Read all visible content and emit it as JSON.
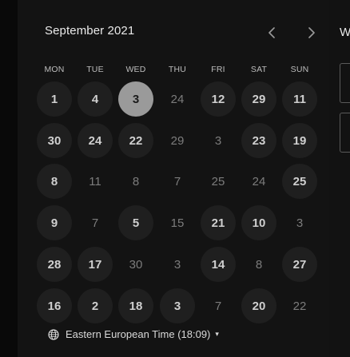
{
  "calendar": {
    "month_label": "September 2021",
    "weekdays": [
      "MON",
      "TUE",
      "WED",
      "THU",
      "FRI",
      "SAT",
      "SUN"
    ],
    "weeks": [
      [
        {
          "d": "1",
          "s": "avail"
        },
        {
          "d": "4",
          "s": "avail"
        },
        {
          "d": "3",
          "s": "selected"
        },
        {
          "d": "24",
          "s": "unavail"
        },
        {
          "d": "12",
          "s": "avail"
        },
        {
          "d": "29",
          "s": "avail"
        },
        {
          "d": "11",
          "s": "avail"
        }
      ],
      [
        {
          "d": "30",
          "s": "avail"
        },
        {
          "d": "24",
          "s": "avail"
        },
        {
          "d": "22",
          "s": "avail"
        },
        {
          "d": "29",
          "s": "unavail"
        },
        {
          "d": "3",
          "s": "unavail"
        },
        {
          "d": "23",
          "s": "avail"
        },
        {
          "d": "19",
          "s": "avail"
        }
      ],
      [
        {
          "d": "8",
          "s": "avail"
        },
        {
          "d": "11",
          "s": "unavail"
        },
        {
          "d": "8",
          "s": "unavail"
        },
        {
          "d": "7",
          "s": "unavail"
        },
        {
          "d": "25",
          "s": "unavail"
        },
        {
          "d": "24",
          "s": "unavail"
        },
        {
          "d": "25",
          "s": "avail"
        }
      ],
      [
        {
          "d": "9",
          "s": "avail"
        },
        {
          "d": "7",
          "s": "unavail"
        },
        {
          "d": "5",
          "s": "avail"
        },
        {
          "d": "15",
          "s": "unavail"
        },
        {
          "d": "21",
          "s": "avail"
        },
        {
          "d": "10",
          "s": "avail"
        },
        {
          "d": "3",
          "s": "unavail"
        }
      ],
      [
        {
          "d": "28",
          "s": "avail"
        },
        {
          "d": "17",
          "s": "avail"
        },
        {
          "d": "30",
          "s": "unavail"
        },
        {
          "d": "3",
          "s": "unavail"
        },
        {
          "d": "14",
          "s": "avail"
        },
        {
          "d": "8",
          "s": "unavail"
        },
        {
          "d": "27",
          "s": "avail"
        }
      ],
      [
        {
          "d": "16",
          "s": "avail"
        },
        {
          "d": "2",
          "s": "avail"
        },
        {
          "d": "18",
          "s": "avail"
        },
        {
          "d": "3",
          "s": "avail"
        },
        {
          "d": "7",
          "s": "unavail"
        },
        {
          "d": "20",
          "s": "avail"
        },
        {
          "d": "22",
          "s": "unavail"
        }
      ]
    ]
  },
  "timezone": {
    "label": "Eastern European Time (18:09)",
    "caret": "▾"
  },
  "right_panel": {
    "heading_initial": "W"
  },
  "icons": {
    "prev": "chevron-left-icon",
    "next": "chevron-right-icon",
    "timezone": "globe-icon"
  },
  "colors": {
    "background": "#131313",
    "available_day_bg": "#1f1f1f",
    "selected_day_bg": "#9a9a9a",
    "unavailable_text": "#7c7c7c"
  }
}
